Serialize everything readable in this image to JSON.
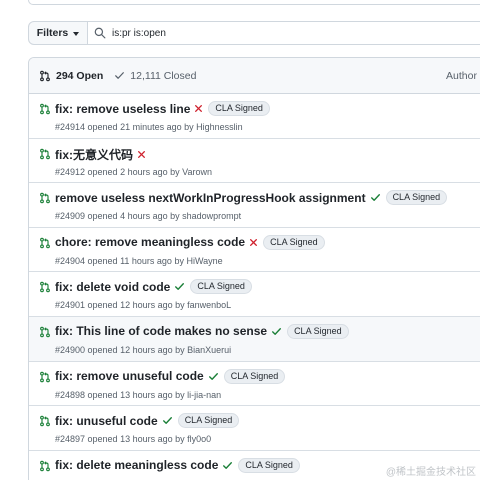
{
  "filter_bar": {
    "filters_label": "Filters",
    "search_value": "is:pr is:open"
  },
  "list_header": {
    "open_label": "294 Open",
    "closed_label": "12,111 Closed",
    "author_label": "Author"
  },
  "pull_requests": [
    {
      "title": "fix: remove useless line",
      "status": "fail",
      "label": "CLA Signed",
      "meta": "#24914 opened 21 minutes ago by Highnesslin"
    },
    {
      "title": "fix:无意义代码",
      "status": "fail",
      "label": "",
      "meta": "#24912 opened 2 hours ago by Varown"
    },
    {
      "title": "remove useless nextWorkInProgressHook assignment",
      "status": "pass",
      "label": "CLA Signed",
      "meta": "#24909 opened 4 hours ago by shadowprompt"
    },
    {
      "title": "chore: remove meaningless code",
      "status": "fail",
      "label": "CLA Signed",
      "meta": "#24904 opened 11 hours ago by HiWayne"
    },
    {
      "title": "fix: delete void code",
      "status": "pass",
      "label": "CLA Signed",
      "meta": "#24901 opened 12 hours ago by fanwenboL"
    },
    {
      "title": "fix: This line of code makes no sense",
      "status": "pass",
      "label": "CLA Signed",
      "meta": "#24900 opened 12 hours ago by BianXuerui"
    },
    {
      "title": "fix: remove unuseful code",
      "status": "pass",
      "label": "CLA Signed",
      "meta": "#24898 opened 13 hours ago by li-jia-nan"
    },
    {
      "title": "fix: unuseful code",
      "status": "pass",
      "label": "CLA Signed",
      "meta": "#24897 opened 13 hours ago by fly0o0"
    },
    {
      "title": "fix: delete meaningless code",
      "status": "pass",
      "label": "CLA Signed",
      "meta": ""
    }
  ],
  "watermark": "@稀土掘金技术社区",
  "colors": {
    "open_green": "#1a7f37",
    "fail_red": "#cf222e",
    "pass_green": "#1a7f37"
  }
}
